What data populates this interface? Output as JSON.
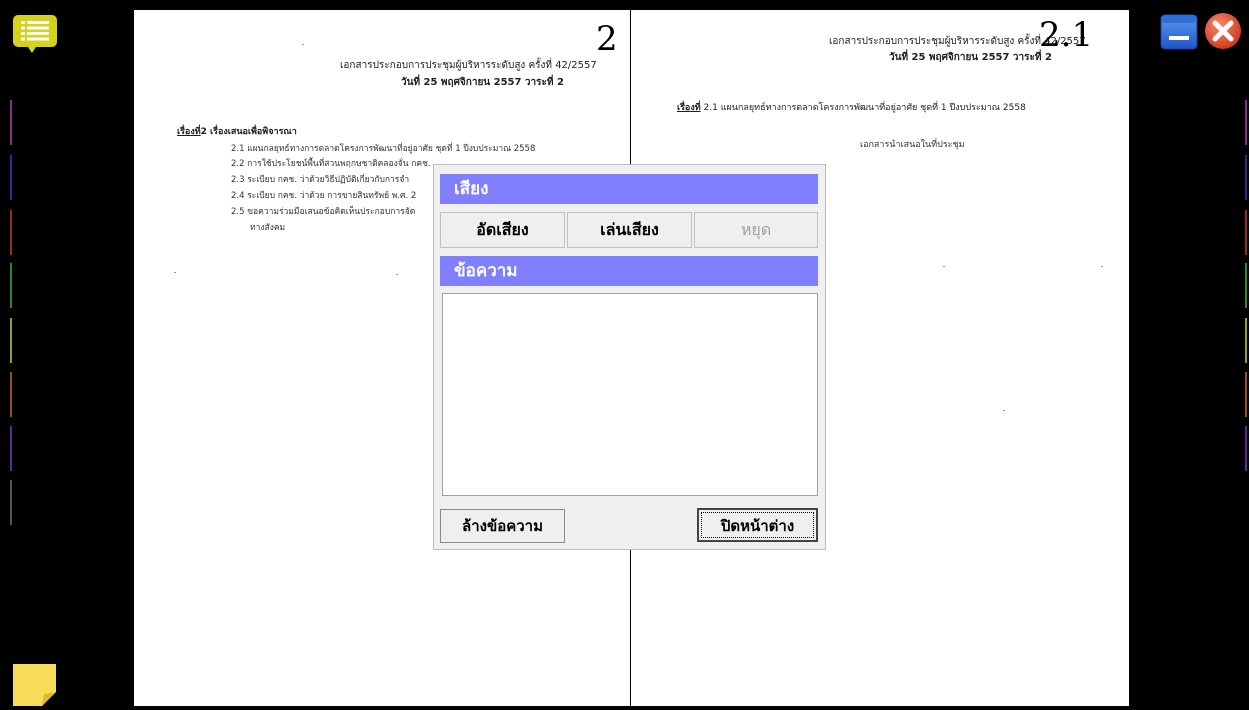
{
  "left_page": {
    "page_number": "2",
    "header_line1": "เอกสารประกอบการประชุมผู้บริหารระดับสูง ครั้งที่ 42/2557",
    "header_line2": "วันที่ 25  พฤศจิกายน 2557 วาระที่ 2",
    "subject_prefix": "เรื่องที่",
    "subject_title": "2  เรื่องเสนอเพื่อพิจารณา",
    "items": [
      "2.1  แผนกลยุทธ์ทางการตลาดโครงการพัฒนาที่อยู่อาศัย ชุดที่ 1 ปีงบประมาณ 2558",
      "2.2  การใช้ประโยชน์พื้นที่สวนพฤกษชาติคลองจั่น กคช.",
      "2.3  ระเบียบ กคช. ว่าด้วยวิธีปฏิบัติเกี่ยวกับการจำ",
      "2.4  ระเบียบ กคช. ว่าด้วย การขายสินทรัพย์ พ.ศ. 2",
      "2.5  ขอความร่วมมือเสนอข้อคิดเห็นประกอบการจัด",
      "ทางสังคม"
    ]
  },
  "right_page": {
    "page_number": "2.1",
    "header_line1": "เอกสารประกอบการประชุมผู้บริหารระดับสูง ครั้งที่ 42/2557",
    "header_line2": "วันที่ 25  พฤศจิกายน 2557 วาระที่ 2",
    "subject_prefix": "เรื่องที่",
    "subject_title": " 2.1 แผนกลยุทธ์ทางการตลาดโครงการพัฒนาที่อยู่อาศัย ชุดที่ 1 ปีงบประมาณ 2558",
    "subtitle": "เอกสารนำเสนอในที่ประชุม"
  },
  "dialog": {
    "sound_header": "เสียง",
    "record_label": "อัดเสียง",
    "play_label": "เล่นเสียง",
    "stop_label": "หยุด",
    "message_header": "ข้อความ",
    "message_value": "",
    "clear_label": "ล้างข้อความ",
    "close_label": "ปิดหน้าต่าง"
  },
  "icons": {
    "menu": "menu-list-icon",
    "minimize": "minimize-icon",
    "close": "close-icon",
    "note": "sticky-note-icon"
  },
  "colors": {
    "section_header": "#8080ff",
    "menu_icon": "#d4d21a",
    "minimize_icon": "#2a63d4",
    "close_icon": "#e04a2a",
    "note_icon": "#f7dc5a"
  }
}
